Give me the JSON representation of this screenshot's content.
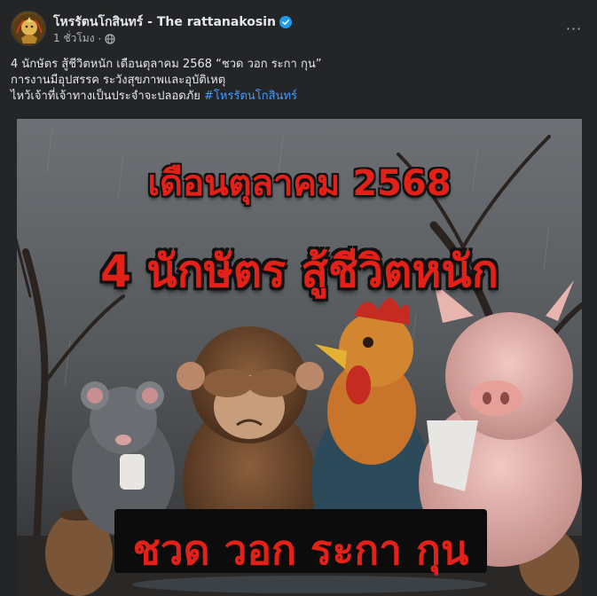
{
  "post": {
    "page_name": "โหรรัตนโกสินทร์ - The rattanakosin",
    "verified_icon": "verified-badge-icon",
    "time": "1 ชั่วโมง",
    "privacy_icon": "globe-icon",
    "more_icon": "more-options-icon",
    "more_label": "···",
    "caption": {
      "line1": "4 นักษัตร สู้ชีวิตหนัก เดือนตุลาคม 2568 “ชวด วอก ระกา กุน”",
      "line2": "การงานมีอุปสรรค ระวังสุขภาพและอุบัติเหตุ",
      "line3": "ไหว้เจ้าที่เจ้าทางเป็นประจำจะปลอดภัย",
      "hashtag": "#โหรรัตนโกสินทร์"
    }
  },
  "image": {
    "title_month": "เดือนตุลาคม 2568",
    "title_main": "4 นักษัตร สู้ชีวิตหนัก",
    "bottom_text": "ชวด วอก ระกา กุน",
    "text_color": "#e32119"
  },
  "colors": {
    "background": "#242526",
    "text": "#e4e6eb",
    "muted": "#b0b3b8",
    "link": "#4599ff",
    "verified": "#1d9bf0"
  }
}
